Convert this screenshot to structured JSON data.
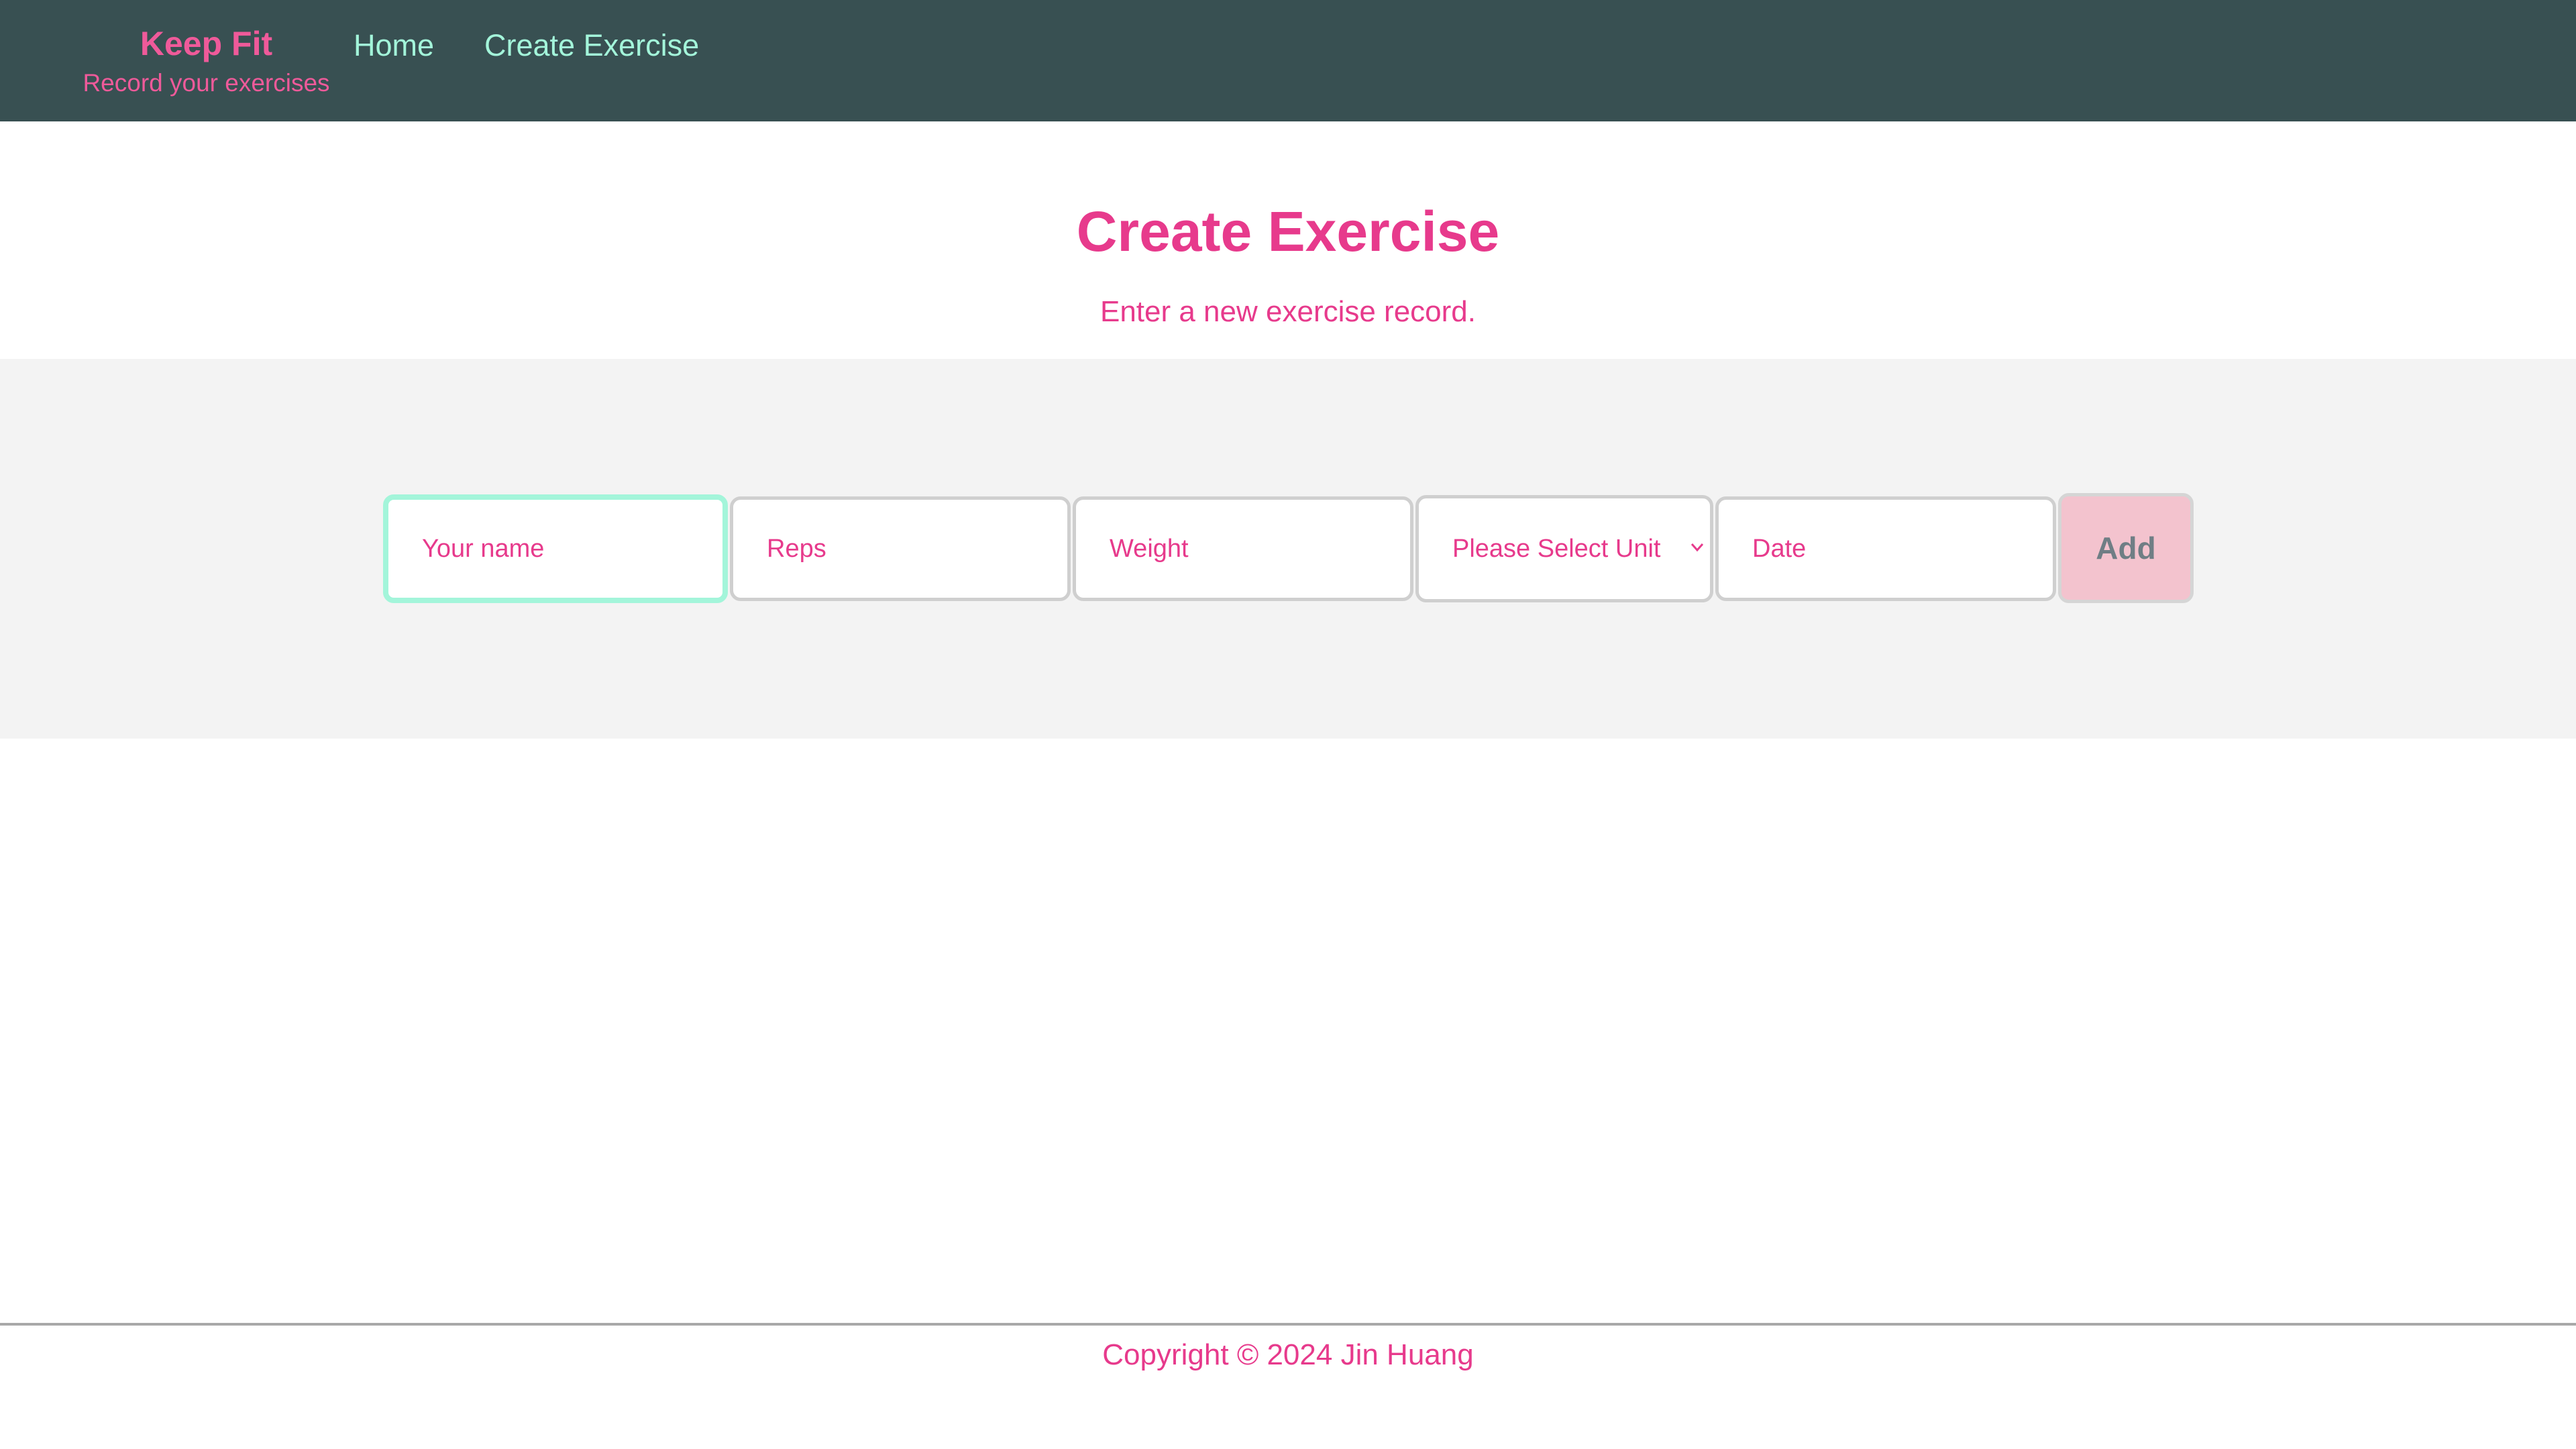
{
  "header": {
    "brand_title": "Keep Fit",
    "brand_subtitle": "Record your exercises",
    "nav": [
      {
        "label": "Home"
      },
      {
        "label": "Create Exercise"
      }
    ]
  },
  "main": {
    "title": "Create Exercise",
    "subtitle": "Enter a new exercise record."
  },
  "form": {
    "name_placeholder": "Your name",
    "reps_placeholder": "Reps",
    "weight_placeholder": "Weight",
    "unit_selected": "Please Select Unit",
    "date_placeholder": "Date",
    "add_label": "Add"
  },
  "footer": {
    "copyright": "Copyright © 2024 Jin Huang"
  },
  "colors": {
    "navbar_bg": "#385052",
    "brand": "#ef5a9a",
    "nav_link": "#a3f5da",
    "accent_pink": "#e73a8c",
    "focus_border": "#a3f5da",
    "add_button_bg": "#f3c3ce",
    "form_band_bg": "#f3f3f3"
  },
  "icons": {
    "select_arrow": "chevron-down-icon"
  }
}
